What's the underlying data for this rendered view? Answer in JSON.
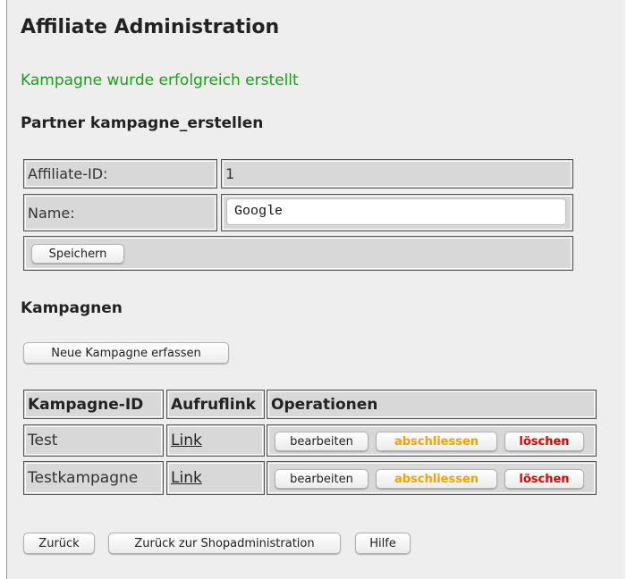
{
  "page": {
    "title": "Affiliate Administration",
    "success_message": "Kampagne wurde erfolgreich erstellt",
    "partner_heading": "Partner kampagne_erstellen"
  },
  "partner_form": {
    "affiliate_id_label": "Affiliate-ID:",
    "affiliate_id_value": "1",
    "name_label": "Name:",
    "name_value": "Google",
    "save_button": "Speichern"
  },
  "campaigns": {
    "heading": "Kampagnen",
    "new_button": "Neue Kampagne erfassen",
    "columns": [
      "Kampagne-ID",
      "Aufruflink",
      "Operationen"
    ],
    "rows": [
      {
        "id": "Test",
        "link": "Link",
        "ops": [
          "bearbeiten",
          "abschliessen",
          "löschen"
        ]
      },
      {
        "id": "Testkampagne",
        "link": "Link",
        "ops": [
          "bearbeiten",
          "abschliessen",
          "löschen"
        ]
      }
    ]
  },
  "footer": {
    "back": "Zurück",
    "back_shop": "Zurück zur Shopadministration",
    "help": "Hilfe"
  },
  "colors": {
    "success": "#1aa01a",
    "abschliessen": "#f5a300",
    "loeschen": "#e00000"
  }
}
